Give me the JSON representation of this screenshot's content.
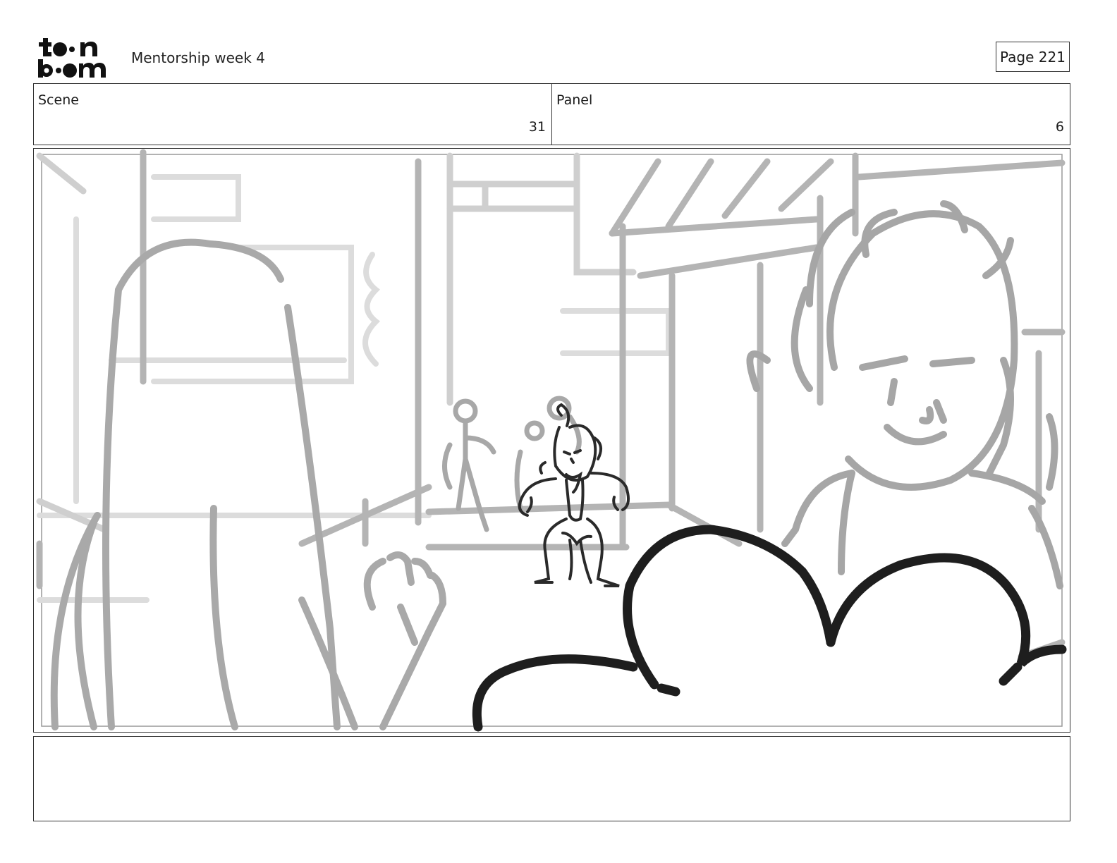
{
  "header": {
    "logo_line1": "toon",
    "logo_line2": "boom",
    "title": "Mentorship week 4",
    "page_label": "Page 221"
  },
  "info": {
    "scene_label": "Scene",
    "scene_value": "31",
    "panel_label": "Panel",
    "panel_value": "6"
  },
  "panel": {
    "image_description_icon": "storyboard-sketch"
  },
  "notes": {
    "text": ""
  }
}
